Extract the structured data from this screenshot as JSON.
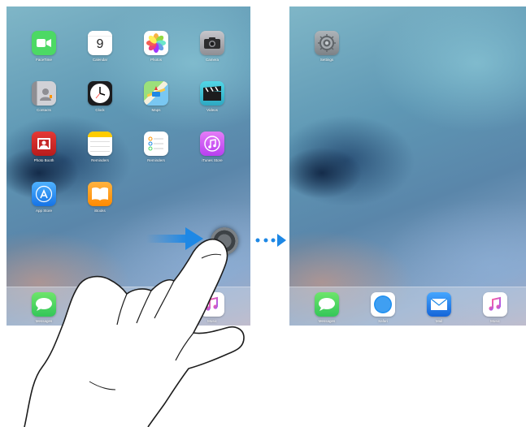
{
  "left_screen": {
    "grid_apps": [
      {
        "label": "FaceTime",
        "icon": "facetime-icon",
        "color": "#4cd964"
      },
      {
        "label": "Calendar",
        "icon": "calendar-icon",
        "day": "9"
      },
      {
        "label": "Photos",
        "icon": "photos-icon"
      },
      {
        "label": "Camera",
        "icon": "camera-icon",
        "color": "#8e8e93"
      },
      {
        "label": "Contacts",
        "icon": "contacts-icon",
        "color": "#b0b4ba"
      },
      {
        "label": "Clock",
        "icon": "clock-icon",
        "color": "#1c1c1e"
      },
      {
        "label": "Maps",
        "icon": "maps-icon"
      },
      {
        "label": "Videos",
        "icon": "videos-icon",
        "color": "#3ec7d6"
      },
      {
        "label": "Photo Booth",
        "icon": "photo-booth-icon",
        "color": "#d32f2f"
      },
      {
        "label": "Reminders",
        "icon": "notes-icon",
        "color": "#ffffff"
      },
      {
        "label": "Reminders",
        "icon": "reminders-icon",
        "color": "#ffffff"
      },
      {
        "label": "iTunes Store",
        "icon": "itunes-store-icon",
        "color": "#d05ff0"
      },
      {
        "label": "App Store",
        "icon": "app-store-icon",
        "color": "#1e8ff0"
      },
      {
        "label": "iBooks",
        "icon": "ibooks-icon",
        "color": "#ff9500"
      }
    ],
    "dock": [
      {
        "label": "Messages",
        "icon": "messages-icon",
        "color": "#4cd964"
      },
      {
        "label": "Music",
        "icon": "music-icon",
        "color": "#ffffff"
      }
    ]
  },
  "right_screen": {
    "grid_apps": [
      {
        "label": "Settings",
        "icon": "settings-icon",
        "color": "#8e8e93"
      }
    ],
    "dock": [
      {
        "label": "Messages",
        "icon": "messages-icon",
        "color": "#4cd964"
      },
      {
        "label": "Safari",
        "icon": "safari-icon",
        "color": "#1e8ff0"
      },
      {
        "label": "Mail",
        "icon": "mail-icon",
        "color": "#1e88e5"
      },
      {
        "label": "Music",
        "icon": "music-icon",
        "color": "#ffffff"
      }
    ]
  },
  "indicator_color": "#1e88e5"
}
